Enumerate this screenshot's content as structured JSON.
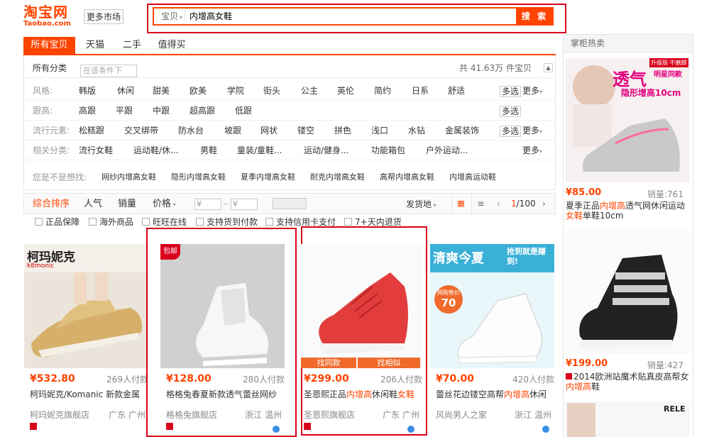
{
  "header": {
    "logo_main": "淘宝网",
    "logo_sub": "Taobao.com",
    "more_market": "更多市场",
    "search_scope": "宝贝",
    "search_value": "内增高女鞋",
    "search_button": "搜 索"
  },
  "tabs": [
    "所有宝贝",
    "天猫",
    "二手",
    "值得买"
  ],
  "categories": {
    "label": "所有分类",
    "filter_placeholder": "在该条件下",
    "count_text": "共 41.63万 件宝贝"
  },
  "filters": [
    {
      "label": "风格:",
      "values": [
        "韩版",
        "休闲",
        "甜美",
        "欧美",
        "学院",
        "街头",
        "公主",
        "英伦",
        "简约",
        "日系",
        "舒适"
      ],
      "multi": "多选",
      "more": "更多"
    },
    {
      "label": "跟高:",
      "values": [
        "高跟",
        "平跟",
        "中跟",
        "超高跟",
        "低跟"
      ],
      "multi": "多选",
      "more": ""
    },
    {
      "label": "流行元素:",
      "values": [
        "松糕跟",
        "交叉绑带",
        "防水台",
        "坡跟",
        "网状",
        "镂空",
        "拼色",
        "浅口",
        "水钻",
        "金属装饰"
      ],
      "multi": "多选",
      "more": "更多"
    },
    {
      "label": "相关分类:",
      "values": [
        "流行女鞋",
        "运动鞋/休...",
        "男鞋",
        "童装/童鞋...",
        "运动/健身...",
        "功能箱包",
        "户外运动..."
      ],
      "multi": "",
      "more": "更多"
    }
  ],
  "suggest": {
    "label": "您是不是想找:",
    "items": [
      "网纱内增高女鞋",
      "隐形内增高女鞋",
      "夏季内增高女鞋",
      "耐克内增高女鞋",
      "高帮内增高女鞋",
      "内增高运动鞋"
    ]
  },
  "sortbar": {
    "items": [
      "综合排序",
      "人气",
      "销量",
      "价格"
    ],
    "price_from": "¥",
    "price_to": "¥",
    "ship_from": "发货地",
    "page": "1",
    "page_total": "/100"
  },
  "checks": [
    "正品保障",
    "海外商品",
    "旺旺在线",
    "支持货到付款",
    "支持信用卡支付",
    "7+天内退货"
  ],
  "products": [
    {
      "brand_text": "柯玛妮克",
      "brand_sub": "k8monic",
      "price": "¥532.80",
      "buyers": "269人付款",
      "title": "柯玛妮克/Komanic 新款金属",
      "shop": "柯玛妮克旗舰店",
      "loc": "广东 广州"
    },
    {
      "badge": "包邮",
      "price": "¥128.00",
      "buyers": "280人付款",
      "title": "格格兔春夏新款透气蕾丝网纱",
      "shop": "格格兔旗舰店",
      "loc": "浙江 温州"
    },
    {
      "price": "¥299.00",
      "buyers": "206人付款",
      "title_pre": "圣恩熙正品",
      "title_hl": "内增高",
      "title_mid": "休闲鞋",
      "title_hl2": "女鞋",
      "shop": "圣恩熙旗舰店",
      "loc": "广东 广州",
      "find_same": "找同款",
      "find_similar": "找相似"
    },
    {
      "banner": "清爽今夏",
      "banner2": "抢到就是赚到!",
      "price": "¥70.00",
      "buyers": "420人付款",
      "title_pre": "蕾丝花边镂空高帮",
      "title_hl": "内增高",
      "title_mid": "休闲",
      "shop": "风尚男人之家",
      "loc": "浙江 温州",
      "tag": "网购售价",
      "tag_price": "70"
    }
  ],
  "sidebar": {
    "title": "掌柜热卖",
    "items": [
      {
        "ad_text": "透气",
        "ad_sub": "明星同款",
        "ad_sub2": "隐形增高10cm",
        "ad_tag": "升级版·不磨脚",
        "price": "¥85.00",
        "sales": "销量:761",
        "title_pre": "夏季正品",
        "title_hl": "内增高",
        "title_mid": "透气网休闲运动",
        "title_hl2": "女鞋",
        "title_post": "单鞋10cm"
      },
      {
        "price": "¥199.00",
        "sales": "销量:427",
        "title_pre": "2014欧洲站魔术贴真皮高帮女",
        "title_hl": "内增高",
        "title_post": "鞋"
      },
      {
        "brand": "RELE"
      }
    ]
  },
  "colors": {
    "accent": "#ff4400",
    "highlight": "#d9001b"
  }
}
